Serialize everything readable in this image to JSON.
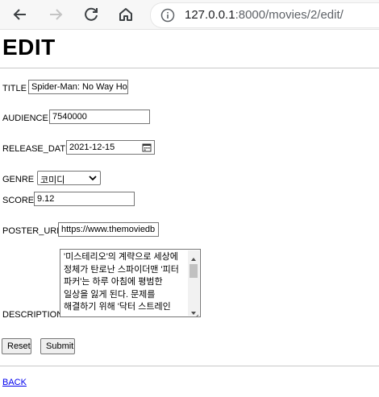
{
  "browser": {
    "url_host": "127.0.0.1",
    "url_rest": ":8000/movies/2/edit/"
  },
  "page": {
    "heading": "EDIT",
    "back_link": "BACK"
  },
  "form": {
    "title_label": "TITLE",
    "title_value": "Spider-Man: No Way Ho",
    "audience_label": "AUDIENCE",
    "audience_value": "7540000",
    "release_label": "RELEASE_DATE",
    "release_value": "2021-12-15",
    "genre_label": "GENRE",
    "genre_value": "코미디",
    "score_label": "SCORE",
    "score_value": "9.12",
    "poster_label": "POSTER_URL",
    "poster_value": "https://www.themoviedb",
    "description_label": "DESCRIPTION",
    "description_value": "'미스테리오'의 계략으로 세상에 정체가 탄로난 스파이더맨 '피터 파커'는 하루 아침에 평범한 일상을 잃게 된다. 문제를 해결하기 위해 '닥터 스트레인",
    "reset_label": "Reset",
    "submit_label": "Submit"
  },
  "icons": [
    "back-arrow-icon",
    "forward-arrow-icon",
    "reload-icon",
    "home-icon",
    "info-icon",
    "calendar-icon",
    "chevron-down-icon"
  ]
}
